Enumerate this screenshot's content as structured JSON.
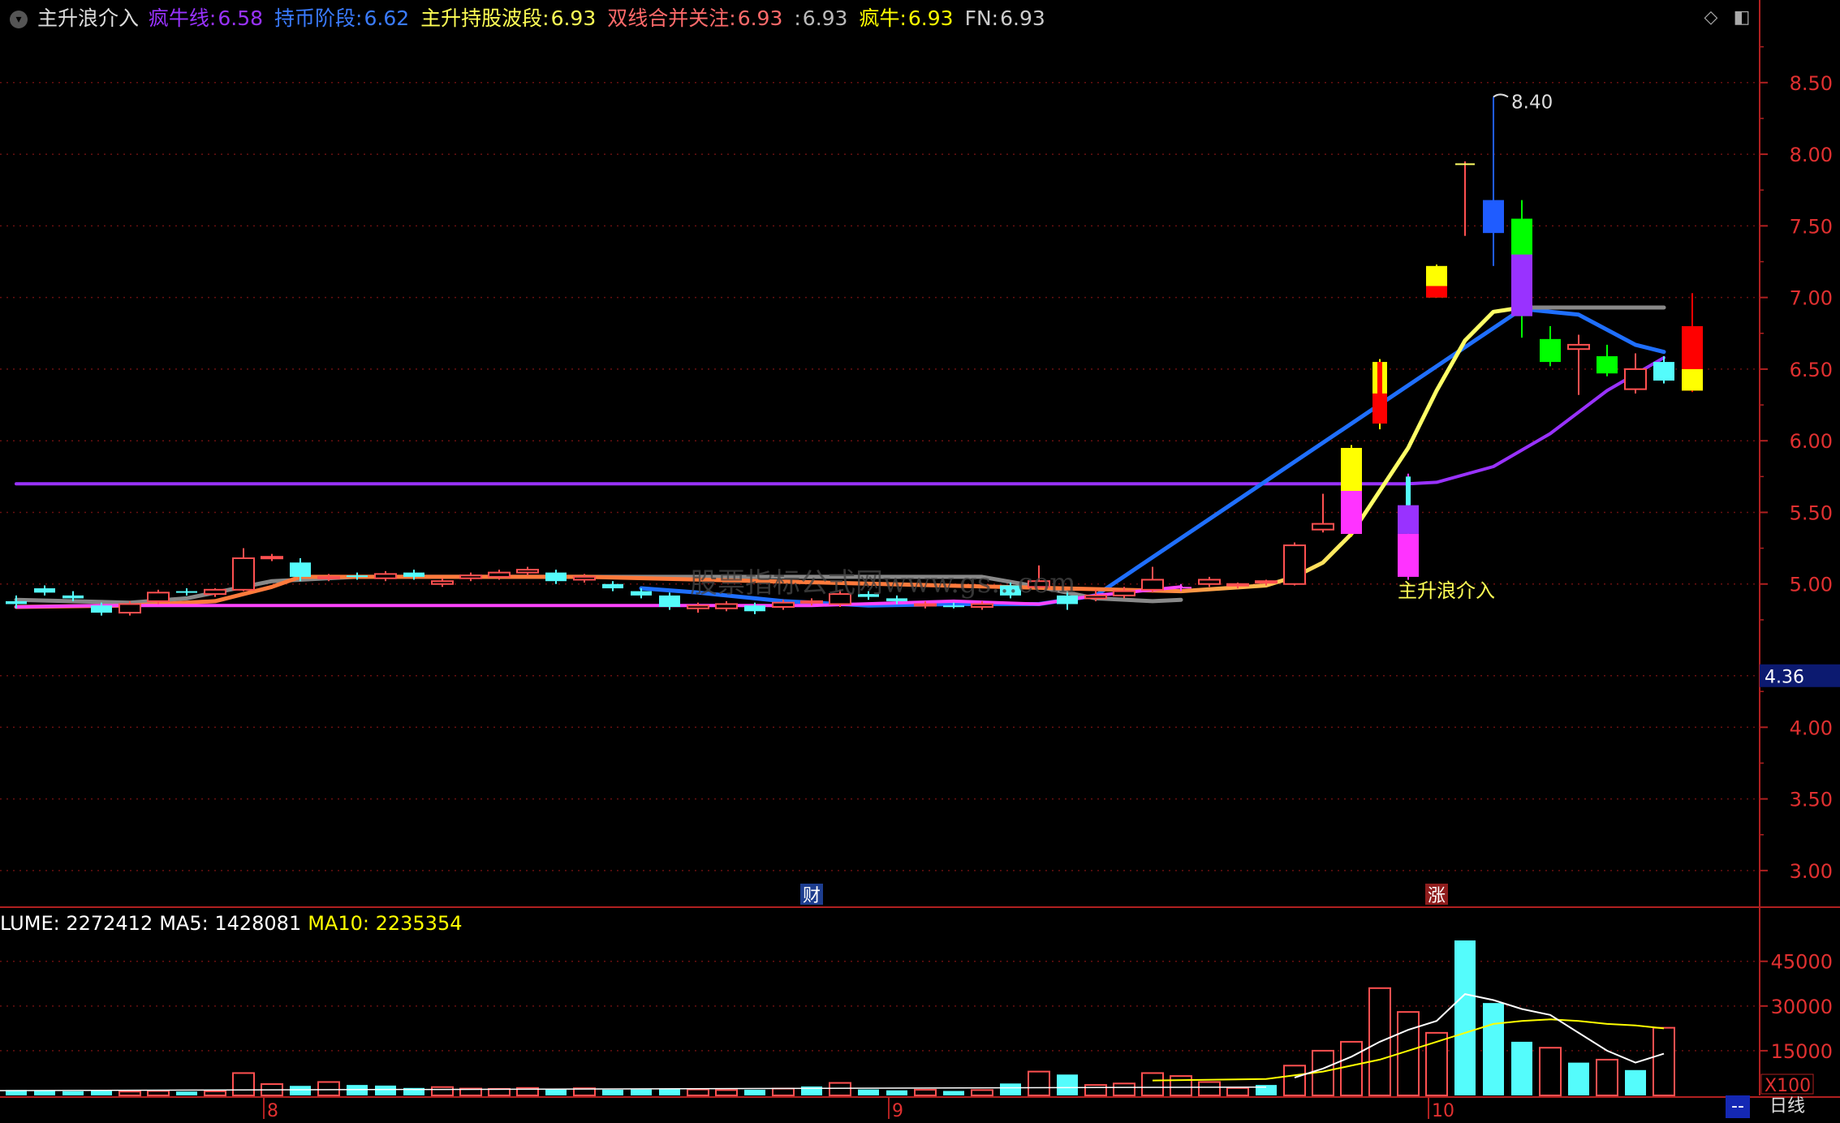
{
  "header": {
    "indicator_name": "主升浪介入",
    "items": [
      {
        "label": "疯牛线:",
        "value": "6.58",
        "color": "#9932ff"
      },
      {
        "label": "持币阶段:",
        "value": "6.62",
        "color": "#3a7bff"
      },
      {
        "label": "主升持股波段:",
        "value": "6.93",
        "color": "#ffff55"
      },
      {
        "label": "双线合并关注:",
        "value": "6.93",
        "color": "#ff6a6a"
      },
      {
        "label": ":",
        "value": "6.93",
        "color": "#bbbbbb"
      },
      {
        "label": "疯牛:",
        "value": "6.93",
        "color": "#ffff00"
      },
      {
        "label": "FN:",
        "value": "6.93",
        "color": "#cccccc"
      }
    ]
  },
  "volume_header": {
    "items": [
      {
        "label": "LUME:",
        "value": "2272412",
        "color": "#ffffff"
      },
      {
        "label": "MA5:",
        "value": "1428081",
        "color": "#ffffff"
      },
      {
        "label": "MA10:",
        "value": "2235354",
        "color": "#ffff00"
      }
    ]
  },
  "price_axis": {
    "ticks": [
      "8.50",
      "8.00",
      "7.50",
      "7.00",
      "6.50",
      "6.00",
      "5.50",
      "5.00",
      "4.00",
      "3.50",
      "3.00"
    ],
    "tick_values": [
      8.5,
      8.0,
      7.5,
      7.0,
      6.5,
      6.0,
      5.5,
      5.0,
      4.0,
      3.5,
      3.0
    ],
    "current_value": "4.36",
    "current_value_num": 4.36
  },
  "volume_axis": {
    "ticks": [
      "45000",
      "30000",
      "15000"
    ],
    "tick_values": [
      45000,
      30000,
      15000
    ],
    "unit": "X100"
  },
  "x_axis": {
    "labels": [
      {
        "text": "8",
        "index": 9
      },
      {
        "text": "9",
        "index": 31
      },
      {
        "text": "10",
        "index": 50
      }
    ]
  },
  "markers": [
    {
      "text": "财",
      "index": 28,
      "bg": "#1d3d8f"
    },
    {
      "text": "涨",
      "index": 50,
      "bg": "#8f1d1d"
    }
  ],
  "annotations": {
    "high_label": "8.40",
    "high_value": 8.4,
    "signal_label": "主升浪介入",
    "watermark": "股票指标公式网www.gs...com"
  },
  "footer": {
    "left_label": "--",
    "period_label": "日线"
  },
  "chart_data": {
    "type": "candlestick",
    "n_bars": 59,
    "price_range": [
      2.75,
      8.85
    ],
    "volume_range": [
      0,
      55000
    ],
    "candles": [
      {
        "o": 4.88,
        "c": 4.86,
        "h": 4.92,
        "l": 4.83,
        "color": "#54fcfc"
      },
      {
        "o": 4.97,
        "c": 4.94,
        "h": 4.99,
        "l": 4.92,
        "color": "#54fcfc"
      },
      {
        "o": 4.92,
        "c": 4.9,
        "h": 4.95,
        "l": 4.88,
        "color": "#54fcfc"
      },
      {
        "o": 4.85,
        "c": 4.8,
        "h": 4.87,
        "l": 4.78,
        "color": "#54fcfc"
      },
      {
        "o": 4.8,
        "c": 4.86,
        "h": 4.88,
        "l": 4.78,
        "color": "#ff5050"
      },
      {
        "o": 4.88,
        "c": 4.94,
        "h": 4.96,
        "l": 4.86,
        "color": "#ff5050"
      },
      {
        "o": 4.95,
        "c": 4.94,
        "h": 4.97,
        "l": 4.92,
        "color": "#54fcfc"
      },
      {
        "o": 4.93,
        "c": 4.96,
        "h": 4.97,
        "l": 4.91,
        "color": "#ff5050"
      },
      {
        "o": 4.96,
        "c": 5.18,
        "h": 5.25,
        "l": 4.95,
        "color": "#ff5050"
      },
      {
        "o": 5.19,
        "c": 5.18,
        "h": 5.21,
        "l": 5.16,
        "color": "#ff5050"
      },
      {
        "o": 5.15,
        "c": 5.05,
        "h": 5.18,
        "l": 5.02,
        "color": "#54fcfc"
      },
      {
        "o": 5.04,
        "c": 5.05,
        "h": 5.07,
        "l": 5.02,
        "color": "#ff5050"
      },
      {
        "o": 5.06,
        "c": 5.05,
        "h": 5.08,
        "l": 5.03,
        "color": "#54fcfc"
      },
      {
        "o": 5.04,
        "c": 5.07,
        "h": 5.09,
        "l": 5.02,
        "color": "#ff5050"
      },
      {
        "o": 5.08,
        "c": 5.05,
        "h": 5.1,
        "l": 5.03,
        "color": "#54fcfc"
      },
      {
        "o": 5.02,
        "c": 5.0,
        "h": 5.04,
        "l": 4.98,
        "color": "#ff5050"
      },
      {
        "o": 5.04,
        "c": 5.06,
        "h": 5.08,
        "l": 5.02,
        "color": "#ff5050"
      },
      {
        "o": 5.08,
        "c": 5.05,
        "h": 5.1,
        "l": 5.03,
        "color": "#ff5050"
      },
      {
        "o": 5.1,
        "c": 5.08,
        "h": 5.12,
        "l": 5.06,
        "color": "#ff5050"
      },
      {
        "o": 5.08,
        "c": 5.02,
        "h": 5.1,
        "l": 5.0,
        "color": "#54fcfc"
      },
      {
        "o": 5.05,
        "c": 5.03,
        "h": 5.07,
        "l": 5.01,
        "color": "#ff5050"
      },
      {
        "o": 5.0,
        "c": 4.97,
        "h": 5.02,
        "l": 4.95,
        "color": "#54fcfc"
      },
      {
        "o": 4.95,
        "c": 4.92,
        "h": 4.97,
        "l": 4.9,
        "color": "#54fcfc"
      },
      {
        "o": 4.92,
        "c": 4.84,
        "h": 4.94,
        "l": 4.82,
        "color": "#54fcfc"
      },
      {
        "o": 4.83,
        "c": 4.85,
        "h": 4.87,
        "l": 4.8,
        "color": "#ff5050"
      },
      {
        "o": 4.83,
        "c": 4.86,
        "h": 4.88,
        "l": 4.81,
        "color": "#ff5050"
      },
      {
        "o": 4.85,
        "c": 4.81,
        "h": 4.87,
        "l": 4.79,
        "color": "#54fcfc"
      },
      {
        "o": 4.84,
        "c": 4.87,
        "h": 4.89,
        "l": 4.82,
        "color": "#ff5050"
      },
      {
        "o": 4.87,
        "c": 4.88,
        "h": 4.9,
        "l": 4.85,
        "color": "#ff5050"
      },
      {
        "o": 4.86,
        "c": 4.93,
        "h": 4.96,
        "l": 4.84,
        "color": "#ff5050"
      },
      {
        "o": 4.93,
        "c": 4.91,
        "h": 4.95,
        "l": 4.89,
        "color": "#54fcfc"
      },
      {
        "o": 4.9,
        "c": 4.88,
        "h": 4.92,
        "l": 4.86,
        "color": "#54fcfc"
      },
      {
        "o": 4.86,
        "c": 4.85,
        "h": 4.88,
        "l": 4.83,
        "color": "#ff5050"
      },
      {
        "o": 4.85,
        "c": 4.84,
        "h": 4.87,
        "l": 4.83,
        "color": "#54fcfc"
      },
      {
        "o": 4.84,
        "c": 4.86,
        "h": 4.88,
        "l": 4.82,
        "color": "#ff5050"
      },
      {
        "o": 4.92,
        "c": 4.99,
        "h": 5.01,
        "l": 4.9,
        "color": "#54fcfc"
      },
      {
        "o": 4.98,
        "c": 5.02,
        "h": 5.13,
        "l": 4.97,
        "color": "#ff5050"
      },
      {
        "o": 4.92,
        "c": 4.86,
        "h": 4.94,
        "l": 4.82,
        "color": "#54fcfc"
      },
      {
        "o": 4.9,
        "c": 4.92,
        "h": 4.96,
        "l": 4.88,
        "color": "#ff5050"
      },
      {
        "o": 4.92,
        "c": 4.95,
        "h": 4.98,
        "l": 4.9,
        "color": "#ff5050"
      },
      {
        "o": 4.96,
        "c": 5.03,
        "h": 5.12,
        "l": 4.94,
        "color": "#ff5050"
      },
      {
        "o": 4.98,
        "c": 4.97,
        "h": 5.0,
        "l": 4.95,
        "color": "#ff4cff"
      },
      {
        "o": 5.0,
        "c": 5.03,
        "h": 5.05,
        "l": 4.98,
        "color": "#ff5050"
      },
      {
        "o": 4.99,
        "c": 5.0,
        "h": 5.01,
        "l": 4.97,
        "color": "#ff5050"
      },
      {
        "o": 5.01,
        "c": 5.02,
        "h": 5.03,
        "l": 4.99,
        "color": "#ff5050"
      },
      {
        "o": 5.0,
        "c": 5.27,
        "h": 5.29,
        "l": 4.99,
        "color": "#ff5050"
      },
      {
        "o": 5.38,
        "c": 5.42,
        "h": 5.63,
        "l": 5.36,
        "color": "#ff5050"
      },
      {
        "o": 5.35,
        "c": 5.95,
        "h": 5.97,
        "l": 5.33,
        "color": "#ffff00",
        "c2": "#ff33ff",
        "split": 5.65
      },
      {
        "o": 6.12,
        "c": 6.55,
        "h": 6.57,
        "l": 6.08,
        "color": "#ffff00",
        "c2": "#ff0000",
        "split": 6.33,
        "narrow": true
      },
      {
        "o": 5.05,
        "c": 5.75,
        "h": 5.77,
        "l": 5.03,
        "color": "#ff33ff",
        "c2": "#9932ff",
        "split": 5.35,
        "c3": "#54fcfc",
        "split2": 5.55
      },
      {
        "o": 7.0,
        "c": 7.22,
        "h": 7.23,
        "l": 7.0,
        "color": "#ffff00",
        "c2": "#ff0000",
        "split": 7.08
      },
      {
        "o": 7.45,
        "c": 7.93,
        "h": 7.95,
        "l": 7.43,
        "color": "#ff5050",
        "thin": true
      },
      {
        "o": 7.45,
        "c": 7.68,
        "h": 8.4,
        "l": 7.22,
        "color": "#1f5cff"
      },
      {
        "o": 6.87,
        "c": 7.55,
        "h": 7.68,
        "l": 6.72,
        "color": "#00ff00",
        "c2": "#9932ff",
        "split": 7.3
      },
      {
        "o": 6.55,
        "c": 6.71,
        "h": 6.8,
        "l": 6.52,
        "color": "#00ff00"
      },
      {
        "o": 6.64,
        "c": 6.67,
        "h": 6.74,
        "l": 6.32,
        "color": "#ff5050"
      },
      {
        "o": 6.47,
        "c": 6.59,
        "h": 6.67,
        "l": 6.45,
        "color": "#00ff00"
      },
      {
        "o": 6.36,
        "c": 6.5,
        "h": 6.61,
        "l": 6.33,
        "color": "#ff5050"
      },
      {
        "o": 6.42,
        "c": 6.55,
        "h": 6.59,
        "l": 6.4,
        "color": "#54fcfc"
      },
      {
        "o": 6.35,
        "c": 6.8,
        "h": 7.03,
        "l": 6.34,
        "color": "#ff0000",
        "c2": "#ffff00",
        "split": 6.5
      }
    ],
    "volume": [
      {
        "v": 1800,
        "color": "#54fcfc"
      },
      {
        "v": 1500,
        "color": "#54fcfc"
      },
      {
        "v": 1400,
        "color": "#54fcfc"
      },
      {
        "v": 1500,
        "color": "#54fcfc"
      },
      {
        "v": 1300,
        "color": "#ff5050"
      },
      {
        "v": 1500,
        "color": "#ff5050"
      },
      {
        "v": 1300,
        "color": "#54fcfc"
      },
      {
        "v": 1400,
        "color": "#ff5050"
      },
      {
        "v": 7500,
        "color": "#ff5050"
      },
      {
        "v": 3800,
        "color": "#ff5050"
      },
      {
        "v": 3200,
        "color": "#54fcfc"
      },
      {
        "v": 4500,
        "color": "#ff5050"
      },
      {
        "v": 3500,
        "color": "#54fcfc"
      },
      {
        "v": 3300,
        "color": "#54fcfc"
      },
      {
        "v": 2500,
        "color": "#54fcfc"
      },
      {
        "v": 2800,
        "color": "#ff5050"
      },
      {
        "v": 2300,
        "color": "#ff5050"
      },
      {
        "v": 2200,
        "color": "#ff5050"
      },
      {
        "v": 2500,
        "color": "#ff5050"
      },
      {
        "v": 2000,
        "color": "#54fcfc"
      },
      {
        "v": 2400,
        "color": "#ff5050"
      },
      {
        "v": 1900,
        "color": "#54fcfc"
      },
      {
        "v": 2000,
        "color": "#54fcfc"
      },
      {
        "v": 2100,
        "color": "#54fcfc"
      },
      {
        "v": 2000,
        "color": "#ff5050"
      },
      {
        "v": 1800,
        "color": "#ff5050"
      },
      {
        "v": 1900,
        "color": "#54fcfc"
      },
      {
        "v": 2300,
        "color": "#ff5050"
      },
      {
        "v": 3000,
        "color": "#54fcfc"
      },
      {
        "v": 4200,
        "color": "#ff5050"
      },
      {
        "v": 2000,
        "color": "#54fcfc"
      },
      {
        "v": 1700,
        "color": "#54fcfc"
      },
      {
        "v": 1900,
        "color": "#ff5050"
      },
      {
        "v": 1500,
        "color": "#54fcfc"
      },
      {
        "v": 1800,
        "color": "#ff5050"
      },
      {
        "v": 4000,
        "color": "#54fcfc"
      },
      {
        "v": 8000,
        "color": "#ff5050"
      },
      {
        "v": 7000,
        "color": "#54fcfc"
      },
      {
        "v": 3500,
        "color": "#ff5050"
      },
      {
        "v": 4000,
        "color": "#ff5050"
      },
      {
        "v": 7500,
        "color": "#ff5050"
      },
      {
        "v": 6500,
        "color": "#ff5050"
      },
      {
        "v": 4500,
        "color": "#ff5050"
      },
      {
        "v": 2500,
        "color": "#ff5050"
      },
      {
        "v": 3500,
        "color": "#54fcfc"
      },
      {
        "v": 10000,
        "color": "#ff5050"
      },
      {
        "v": 15000,
        "color": "#ff5050"
      },
      {
        "v": 18000,
        "color": "#ff5050"
      },
      {
        "v": 36000,
        "color": "#ff5050"
      },
      {
        "v": 28000,
        "color": "#ff5050"
      },
      {
        "v": 21000,
        "color": "#ff5050"
      },
      {
        "v": 52000,
        "color": "#54fcfc"
      },
      {
        "v": 31000,
        "color": "#54fcfc"
      },
      {
        "v": 18000,
        "color": "#54fcfc"
      },
      {
        "v": 16000,
        "color": "#ff5050"
      },
      {
        "v": 11000,
        "color": "#54fcfc"
      },
      {
        "v": 12000,
        "color": "#ff5050"
      },
      {
        "v": 8500,
        "color": "#54fcfc"
      },
      {
        "v": 22700,
        "color": "#ff5050"
      }
    ],
    "lines": [
      {
        "name": "疯牛线",
        "color": "#9932ff",
        "width": 4,
        "points": [
          [
            0,
            5.7
          ],
          [
            49,
            5.7
          ],
          [
            50,
            5.71
          ],
          [
            52,
            5.82
          ],
          [
            54,
            6.05
          ],
          [
            56,
            6.35
          ],
          [
            58,
            6.58
          ]
        ]
      },
      {
        "name": "持币阶段",
        "color": "#1f6fff",
        "width": 5,
        "points": [
          [
            22,
            4.97
          ],
          [
            24,
            4.94
          ],
          [
            27,
            4.88
          ],
          [
            30,
            4.85
          ],
          [
            33,
            4.86
          ],
          [
            36,
            4.86
          ],
          [
            38,
            4.92
          ],
          [
            53,
            6.92
          ],
          [
            55,
            6.88
          ],
          [
            57,
            6.67
          ],
          [
            58,
            6.62
          ]
        ]
      },
      {
        "name": "主升持股波段",
        "color": "#888888",
        "width": 5,
        "points": [
          [
            0,
            4.89
          ],
          [
            4,
            4.87
          ],
          [
            6,
            4.9
          ],
          [
            9,
            5.02
          ],
          [
            12,
            5.05
          ],
          [
            20,
            5.05
          ],
          [
            34,
            5.05
          ],
          [
            36,
            4.98
          ],
          [
            38,
            4.9
          ],
          [
            40,
            4.88
          ],
          [
            41,
            4.89
          ]
        ]
      },
      {
        "name": "主升持股波段2",
        "color": "#888888",
        "width": 5,
        "points": [
          [
            53,
            6.93
          ],
          [
            58,
            6.93
          ]
        ]
      },
      {
        "name": "疯牛",
        "color": "#ff8c3c",
        "width": 5,
        "points": [
          [
            0,
            4.84
          ],
          [
            4,
            4.85
          ],
          [
            7,
            4.88
          ],
          [
            9,
            4.98
          ],
          [
            10,
            5.05
          ],
          [
            14,
            5.05
          ],
          [
            20,
            5.05
          ],
          [
            41,
            4.95
          ],
          [
            44,
            4.99
          ],
          [
            45,
            5.05
          ],
          [
            46,
            5.15
          ],
          [
            47,
            5.35
          ],
          [
            48,
            5.65
          ],
          [
            49,
            5.95
          ],
          [
            50,
            6.35
          ],
          [
            51,
            6.7
          ],
          [
            52,
            6.9
          ],
          [
            53,
            6.93
          ]
        ],
        "gradient": [
          "#ff7a3c",
          "#ffff66"
        ]
      },
      {
        "name": "FN",
        "color": "#ff44ff",
        "width": 4,
        "points": [
          [
            0,
            4.84
          ],
          [
            3,
            4.85
          ],
          [
            28,
            4.85
          ],
          [
            33,
            4.88
          ],
          [
            36,
            4.86
          ],
          [
            38,
            4.92
          ],
          [
            41,
            4.98
          ]
        ]
      }
    ],
    "vol_ma5": [
      [
        45,
        6000
      ],
      [
        46,
        9000
      ],
      [
        47,
        13000
      ],
      [
        48,
        18000
      ],
      [
        49,
        22000
      ],
      [
        50,
        25000
      ],
      [
        51,
        34000
      ],
      [
        52,
        32000
      ],
      [
        53,
        29000
      ],
      [
        54,
        27000
      ],
      [
        55,
        21000
      ],
      [
        56,
        15000
      ],
      [
        57,
        11000
      ],
      [
        58,
        14000
      ]
    ],
    "vol_ma10": [
      [
        40,
        5000
      ],
      [
        44,
        5500
      ],
      [
        46,
        8000
      ],
      [
        48,
        12000
      ],
      [
        50,
        18000
      ],
      [
        51,
        21000
      ],
      [
        52,
        24000
      ],
      [
        53,
        25000
      ],
      [
        54,
        25500
      ],
      [
        55,
        25000
      ],
      [
        56,
        24000
      ],
      [
        57,
        23500
      ],
      [
        58,
        22500
      ]
    ]
  }
}
